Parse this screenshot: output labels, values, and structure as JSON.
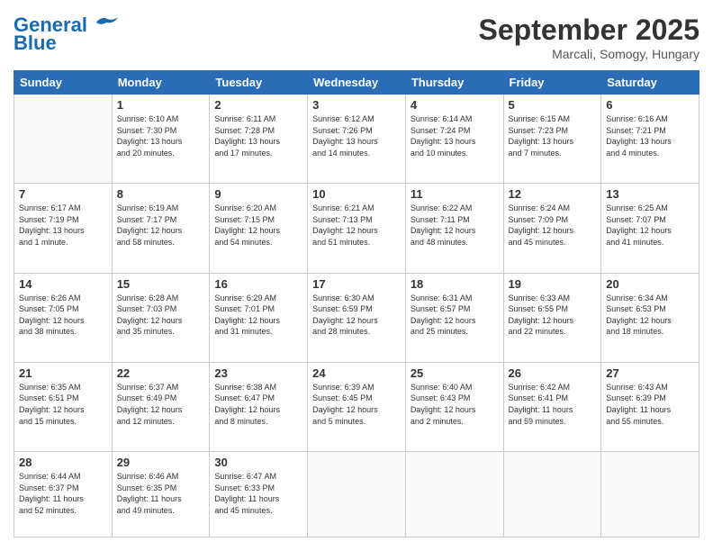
{
  "header": {
    "logo_line1": "General",
    "logo_line2": "Blue",
    "month": "September 2025",
    "location": "Marcali, Somogy, Hungary"
  },
  "days_of_week": [
    "Sunday",
    "Monday",
    "Tuesday",
    "Wednesday",
    "Thursday",
    "Friday",
    "Saturday"
  ],
  "weeks": [
    [
      {
        "day": "",
        "info": ""
      },
      {
        "day": "1",
        "info": "Sunrise: 6:10 AM\nSunset: 7:30 PM\nDaylight: 13 hours\nand 20 minutes."
      },
      {
        "day": "2",
        "info": "Sunrise: 6:11 AM\nSunset: 7:28 PM\nDaylight: 13 hours\nand 17 minutes."
      },
      {
        "day": "3",
        "info": "Sunrise: 6:12 AM\nSunset: 7:26 PM\nDaylight: 13 hours\nand 14 minutes."
      },
      {
        "day": "4",
        "info": "Sunrise: 6:14 AM\nSunset: 7:24 PM\nDaylight: 13 hours\nand 10 minutes."
      },
      {
        "day": "5",
        "info": "Sunrise: 6:15 AM\nSunset: 7:23 PM\nDaylight: 13 hours\nand 7 minutes."
      },
      {
        "day": "6",
        "info": "Sunrise: 6:16 AM\nSunset: 7:21 PM\nDaylight: 13 hours\nand 4 minutes."
      }
    ],
    [
      {
        "day": "7",
        "info": "Sunrise: 6:17 AM\nSunset: 7:19 PM\nDaylight: 13 hours\nand 1 minute."
      },
      {
        "day": "8",
        "info": "Sunrise: 6:19 AM\nSunset: 7:17 PM\nDaylight: 12 hours\nand 58 minutes."
      },
      {
        "day": "9",
        "info": "Sunrise: 6:20 AM\nSunset: 7:15 PM\nDaylight: 12 hours\nand 54 minutes."
      },
      {
        "day": "10",
        "info": "Sunrise: 6:21 AM\nSunset: 7:13 PM\nDaylight: 12 hours\nand 51 minutes."
      },
      {
        "day": "11",
        "info": "Sunrise: 6:22 AM\nSunset: 7:11 PM\nDaylight: 12 hours\nand 48 minutes."
      },
      {
        "day": "12",
        "info": "Sunrise: 6:24 AM\nSunset: 7:09 PM\nDaylight: 12 hours\nand 45 minutes."
      },
      {
        "day": "13",
        "info": "Sunrise: 6:25 AM\nSunset: 7:07 PM\nDaylight: 12 hours\nand 41 minutes."
      }
    ],
    [
      {
        "day": "14",
        "info": "Sunrise: 6:26 AM\nSunset: 7:05 PM\nDaylight: 12 hours\nand 38 minutes."
      },
      {
        "day": "15",
        "info": "Sunrise: 6:28 AM\nSunset: 7:03 PM\nDaylight: 12 hours\nand 35 minutes."
      },
      {
        "day": "16",
        "info": "Sunrise: 6:29 AM\nSunset: 7:01 PM\nDaylight: 12 hours\nand 31 minutes."
      },
      {
        "day": "17",
        "info": "Sunrise: 6:30 AM\nSunset: 6:59 PM\nDaylight: 12 hours\nand 28 minutes."
      },
      {
        "day": "18",
        "info": "Sunrise: 6:31 AM\nSunset: 6:57 PM\nDaylight: 12 hours\nand 25 minutes."
      },
      {
        "day": "19",
        "info": "Sunrise: 6:33 AM\nSunset: 6:55 PM\nDaylight: 12 hours\nand 22 minutes."
      },
      {
        "day": "20",
        "info": "Sunrise: 6:34 AM\nSunset: 6:53 PM\nDaylight: 12 hours\nand 18 minutes."
      }
    ],
    [
      {
        "day": "21",
        "info": "Sunrise: 6:35 AM\nSunset: 6:51 PM\nDaylight: 12 hours\nand 15 minutes."
      },
      {
        "day": "22",
        "info": "Sunrise: 6:37 AM\nSunset: 6:49 PM\nDaylight: 12 hours\nand 12 minutes."
      },
      {
        "day": "23",
        "info": "Sunrise: 6:38 AM\nSunset: 6:47 PM\nDaylight: 12 hours\nand 8 minutes."
      },
      {
        "day": "24",
        "info": "Sunrise: 6:39 AM\nSunset: 6:45 PM\nDaylight: 12 hours\nand 5 minutes."
      },
      {
        "day": "25",
        "info": "Sunrise: 6:40 AM\nSunset: 6:43 PM\nDaylight: 12 hours\nand 2 minutes."
      },
      {
        "day": "26",
        "info": "Sunrise: 6:42 AM\nSunset: 6:41 PM\nDaylight: 11 hours\nand 59 minutes."
      },
      {
        "day": "27",
        "info": "Sunrise: 6:43 AM\nSunset: 6:39 PM\nDaylight: 11 hours\nand 55 minutes."
      }
    ],
    [
      {
        "day": "28",
        "info": "Sunrise: 6:44 AM\nSunset: 6:37 PM\nDaylight: 11 hours\nand 52 minutes."
      },
      {
        "day": "29",
        "info": "Sunrise: 6:46 AM\nSunset: 6:35 PM\nDaylight: 11 hours\nand 49 minutes."
      },
      {
        "day": "30",
        "info": "Sunrise: 6:47 AM\nSunset: 6:33 PM\nDaylight: 11 hours\nand 45 minutes."
      },
      {
        "day": "",
        "info": ""
      },
      {
        "day": "",
        "info": ""
      },
      {
        "day": "",
        "info": ""
      },
      {
        "day": "",
        "info": ""
      }
    ]
  ]
}
